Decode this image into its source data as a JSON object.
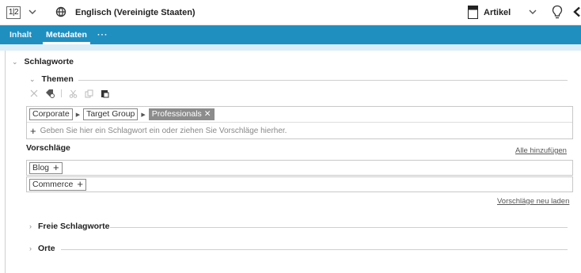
{
  "topbar": {
    "page_indicator": "1|2",
    "language": "Englisch (Vereinigte Staaten)",
    "doc_type": "Artikel"
  },
  "tabs": [
    {
      "label": "Inhalt"
    },
    {
      "label": "Metadaten",
      "active": true
    },
    {
      "label": "···"
    }
  ],
  "section": {
    "title": "Schlagworte",
    "themes": {
      "title": "Themen",
      "path": [
        "Corporate",
        "Target Group"
      ],
      "selected_tag": "Professionals",
      "add_hint": "Geben Sie hier ein Schlagwort ein oder ziehen Sie Vorschläge hierher."
    },
    "suggestions": {
      "title": "Vorschläge",
      "add_all": "Alle hinzufügen",
      "items": [
        "Blog",
        "Commerce"
      ],
      "reload": "Vorschläge neu laden"
    },
    "free_tags": {
      "title": "Freie Schlagworte"
    },
    "places": {
      "title": "Orte"
    }
  },
  "icons": [
    "page-number-icon",
    "chevron-down-icon",
    "globe-icon",
    "document-icon",
    "lightbulb-icon",
    "arrow-left-icon",
    "delete-icon",
    "tag-settings-icon",
    "cut-icon",
    "copy-icon",
    "paste-icon"
  ],
  "colors": {
    "accent": "#1f8fc0",
    "chip_active": "#8c8c8c"
  }
}
